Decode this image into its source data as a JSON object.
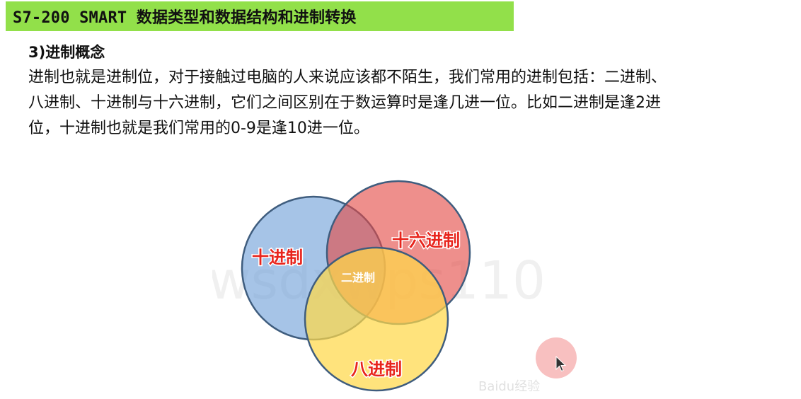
{
  "header": {
    "title": "S7-200 SMART 数据类型和数据结构和进制转换"
  },
  "section": {
    "heading": "3)进制概念",
    "lines": [
      "进制也就是进制位，对于接触过电脑的人来说应该都不陌生，我们常用的进制包括：二进制、",
      "八进制、十进制与十六进制，它们之间区别在于数运算时是逢几进一位。比如二进制是逢2进",
      "位，十进制也就是我们常用的0-9是逢10进一位。"
    ]
  },
  "diagram": {
    "labels": {
      "decimal": "十进制",
      "hexadecimal": "十六进制",
      "octal": "八进制",
      "binary": "二进制"
    },
    "watermark": "wsdxwps110",
    "logo_text": "Baidu经验",
    "colors": {
      "decimal_fill": "#6f9fd8",
      "hexadecimal_fill": "#e44a45",
      "octal_fill": "#ffd84a",
      "label_red": "#e8241c",
      "circle_stroke": "#3f5d7e"
    }
  },
  "cursor": {
    "icon": "mouse-pointer-icon",
    "halo_color": "#f28c8c"
  }
}
